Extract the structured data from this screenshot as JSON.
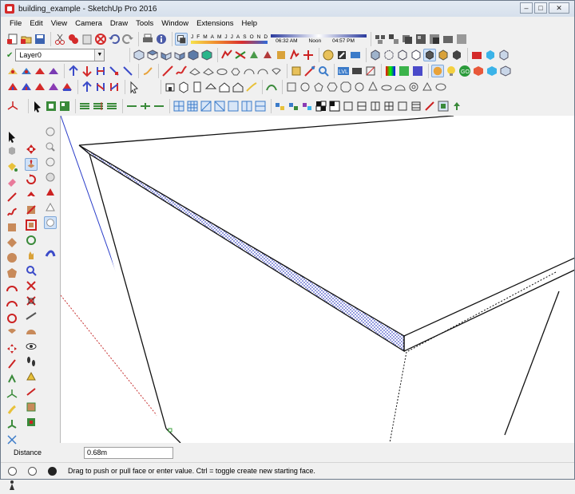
{
  "window": {
    "title": "building_example - SketchUp Pro 2016",
    "minimize": "–",
    "maximize": "□",
    "close": "✕"
  },
  "menu": [
    "File",
    "Edit",
    "View",
    "Camera",
    "Draw",
    "Tools",
    "Window",
    "Extensions",
    "Help"
  ],
  "layer": {
    "current": "Layer0"
  },
  "shadow": {
    "months": [
      "J",
      "F",
      "M",
      "A",
      "M",
      "J",
      "J",
      "A",
      "S",
      "O",
      "N",
      "D"
    ],
    "time_start": "06:32 AM",
    "time_noon": "Noon",
    "time_end": "04:57 PM"
  },
  "measurements": {
    "label": "Distance",
    "value": "0.68m"
  },
  "status": {
    "text": "Drag to push or pull face or enter value.  Ctrl = toggle create new starting face."
  },
  "colors": {
    "accent_red": "#d42a2a",
    "axis_blue": "#2b3ec9",
    "axis_green": "#3ba23b",
    "axis_red": "#c73333",
    "highlight": "#cfe1f7"
  },
  "icons": {
    "row1": [
      "new-icon",
      "open-icon",
      "save-icon",
      "cut-icon",
      "copy-icon",
      "paste-icon",
      "erase-icon",
      "undo-icon",
      "redo-icon",
      "print-icon",
      "model-info-icon",
      "shadows-toggle-icon"
    ],
    "row2": [
      "iso-view-icon",
      "top-view-icon",
      "front-view-icon",
      "right-view-icon",
      "back-view-icon",
      "left-view-icon",
      "xray-icon",
      "back-edges-icon",
      "wireframe-icon",
      "hidden-line-icon",
      "shaded-icon",
      "textures-icon",
      "monochrome-icon"
    ],
    "left": [
      "select-icon",
      "component-icon",
      "paint-bucket-icon",
      "eraser-icon",
      "line-icon",
      "freehand-icon",
      "rectangle-icon",
      "rotated-rect-icon",
      "circle-icon",
      "polygon-icon",
      "arc-icon",
      "pie-icon",
      "push-pull-icon",
      "follow-me-icon",
      "offset-icon",
      "move-icon",
      "rotate-icon",
      "scale-icon",
      "tape-measure-icon",
      "dimension-icon",
      "protractor-icon",
      "text-icon",
      "axes-icon",
      "3d-text-icon",
      "orbit-icon",
      "pan-icon",
      "zoom-icon",
      "zoom-extents-icon",
      "previous-view-icon",
      "position-camera-icon",
      "walk-icon",
      "look-around-icon",
      "section-plane-icon"
    ]
  }
}
